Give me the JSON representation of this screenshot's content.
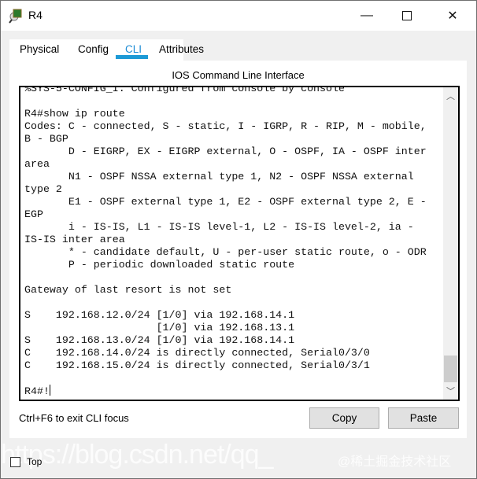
{
  "window": {
    "title": "R4"
  },
  "tabs": [
    {
      "label": "Physical"
    },
    {
      "label": "Config"
    },
    {
      "label": "CLI",
      "active": true
    },
    {
      "label": "Attributes"
    }
  ],
  "cli": {
    "heading": "IOS Command Line Interface",
    "lines": [
      "%SYS-5-CONFIG_I: Configured from console by console",
      "",
      "R4#show ip route",
      "Codes: C - connected, S - static, I - IGRP, R - RIP, M - mobile,",
      "B - BGP",
      "       D - EIGRP, EX - EIGRP external, O - OSPF, IA - OSPF inter",
      "area",
      "       N1 - OSPF NSSA external type 1, N2 - OSPF NSSA external",
      "type 2",
      "       E1 - OSPF external type 1, E2 - OSPF external type 2, E -",
      "EGP",
      "       i - IS-IS, L1 - IS-IS level-1, L2 - IS-IS level-2, ia -",
      "IS-IS inter area",
      "       * - candidate default, U - per-user static route, o - ODR",
      "       P - periodic downloaded static route",
      "",
      "Gateway of last resort is not set",
      "",
      "S    192.168.12.0/24 [1/0] via 192.168.14.1",
      "                     [1/0] via 192.168.13.1",
      "S    192.168.13.0/24 [1/0] via 192.168.14.1",
      "C    192.168.14.0/24 is directly connected, Serial0/3/0",
      "C    192.168.15.0/24 is directly connected, Serial0/3/1",
      "",
      "R4#!"
    ],
    "scroll_position_pct": 100
  },
  "footer": {
    "hint": "Ctrl+F6 to exit CLI focus",
    "copy_label": "Copy",
    "paste_label": "Paste",
    "top_label": "Top",
    "top_checked": false
  },
  "watermark": {
    "url": "https://blog.csdn.net/qq_",
    "site": "@稀土掘金技术社区"
  },
  "colors": {
    "accent": "#1d9ad6"
  }
}
